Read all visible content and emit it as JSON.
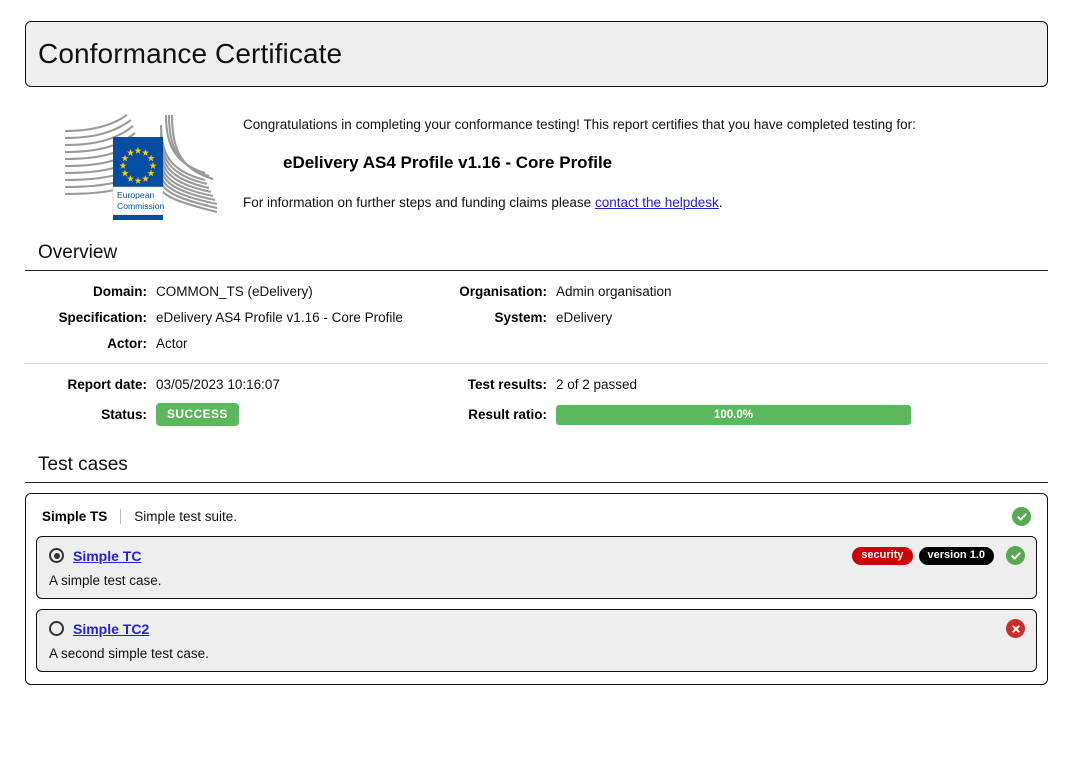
{
  "header": {
    "title": "Conformance Certificate"
  },
  "logo": {
    "name": "european-commission-logo",
    "line1": "European",
    "line2": "Commission",
    "flag_color": "#034ea2",
    "star_color": "#ffcc00",
    "wing_color": "#9a9a9a"
  },
  "intro": {
    "congratulations": "Congratulations in completing your conformance testing! This report certifies that you have completed testing for:",
    "profile": "eDelivery AS4 Profile v1.16 - Core Profile",
    "further_prefix": "For information on further steps and funding claims please ",
    "helpdesk_link": "contact the helpdesk",
    "further_suffix": "."
  },
  "overview": {
    "heading": "Overview",
    "rows_top": [
      {
        "label_left": "Domain:",
        "value_left": "COMMON_TS (eDelivery)",
        "label_right": "Organisation:",
        "value_right": "Admin organisation"
      },
      {
        "label_left": "Specification:",
        "value_left": "eDelivery AS4 Profile v1.16 - Core Profile",
        "label_right": "System:",
        "value_right": "eDelivery"
      },
      {
        "label_left": "Actor:",
        "value_left": "Actor",
        "label_right": "",
        "value_right": ""
      }
    ],
    "report_date_label": "Report date:",
    "report_date_value": "03/05/2023 10:16:07",
    "status_label": "Status:",
    "status_value": "SUCCESS",
    "status_color": "#5cb85c",
    "test_results_label": "Test results:",
    "test_results_value": "2 of 2 passed",
    "result_ratio_label": "Result ratio:",
    "result_ratio_value": "100.0%",
    "result_ratio_percent": 100
  },
  "test_cases": {
    "heading": "Test cases",
    "suite": {
      "name": "Simple TS",
      "description": "Simple test suite.",
      "status": "success"
    },
    "items": [
      {
        "name": "Simple TC",
        "description": "A simple test case.",
        "selected": true,
        "status": "success",
        "tags": [
          {
            "label": "security",
            "color": "#cc0000"
          },
          {
            "label": "version 1.0",
            "color": "#000000"
          }
        ]
      },
      {
        "name": "Simple TC2",
        "description": "A second simple test case.",
        "selected": false,
        "status": "error",
        "tags": []
      }
    ]
  }
}
